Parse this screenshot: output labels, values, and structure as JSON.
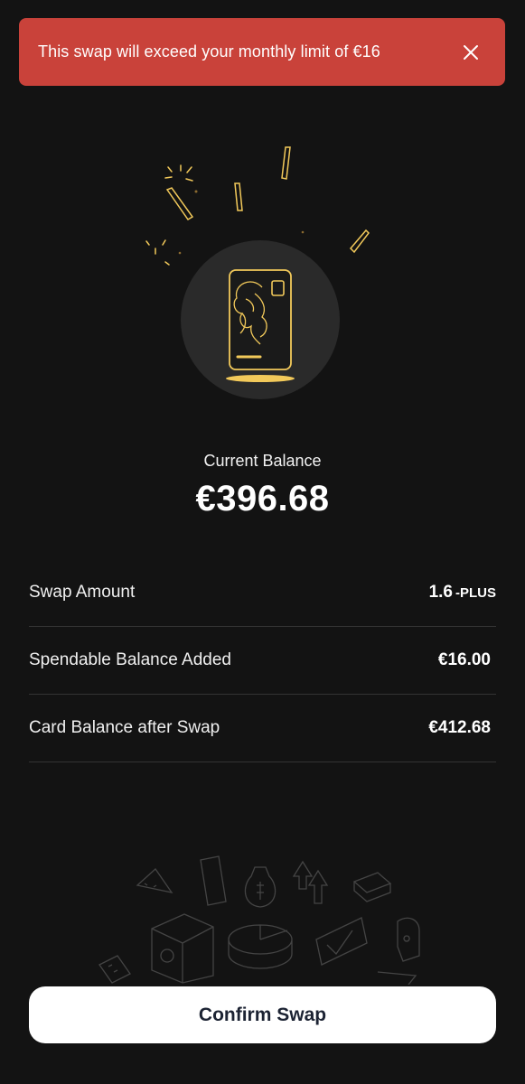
{
  "alert": {
    "message": "This swap will exceed your monthly limit of €16",
    "close_icon": "close-icon",
    "color": "#c9423a"
  },
  "balance": {
    "label": "Current Balance",
    "value": "€396.68"
  },
  "summary": [
    {
      "label": "Swap Amount",
      "value": "1.6",
      "unit": "PLUS"
    },
    {
      "label": "Spendable Balance Added",
      "value": "€16.00"
    },
    {
      "label": "Card Balance after Swap",
      "value": "€412.68"
    }
  ],
  "confirm_button": {
    "label": "Confirm Swap"
  },
  "colors": {
    "background": "#131313",
    "accent": "#f2c95a",
    "button_text": "#1c2333"
  }
}
